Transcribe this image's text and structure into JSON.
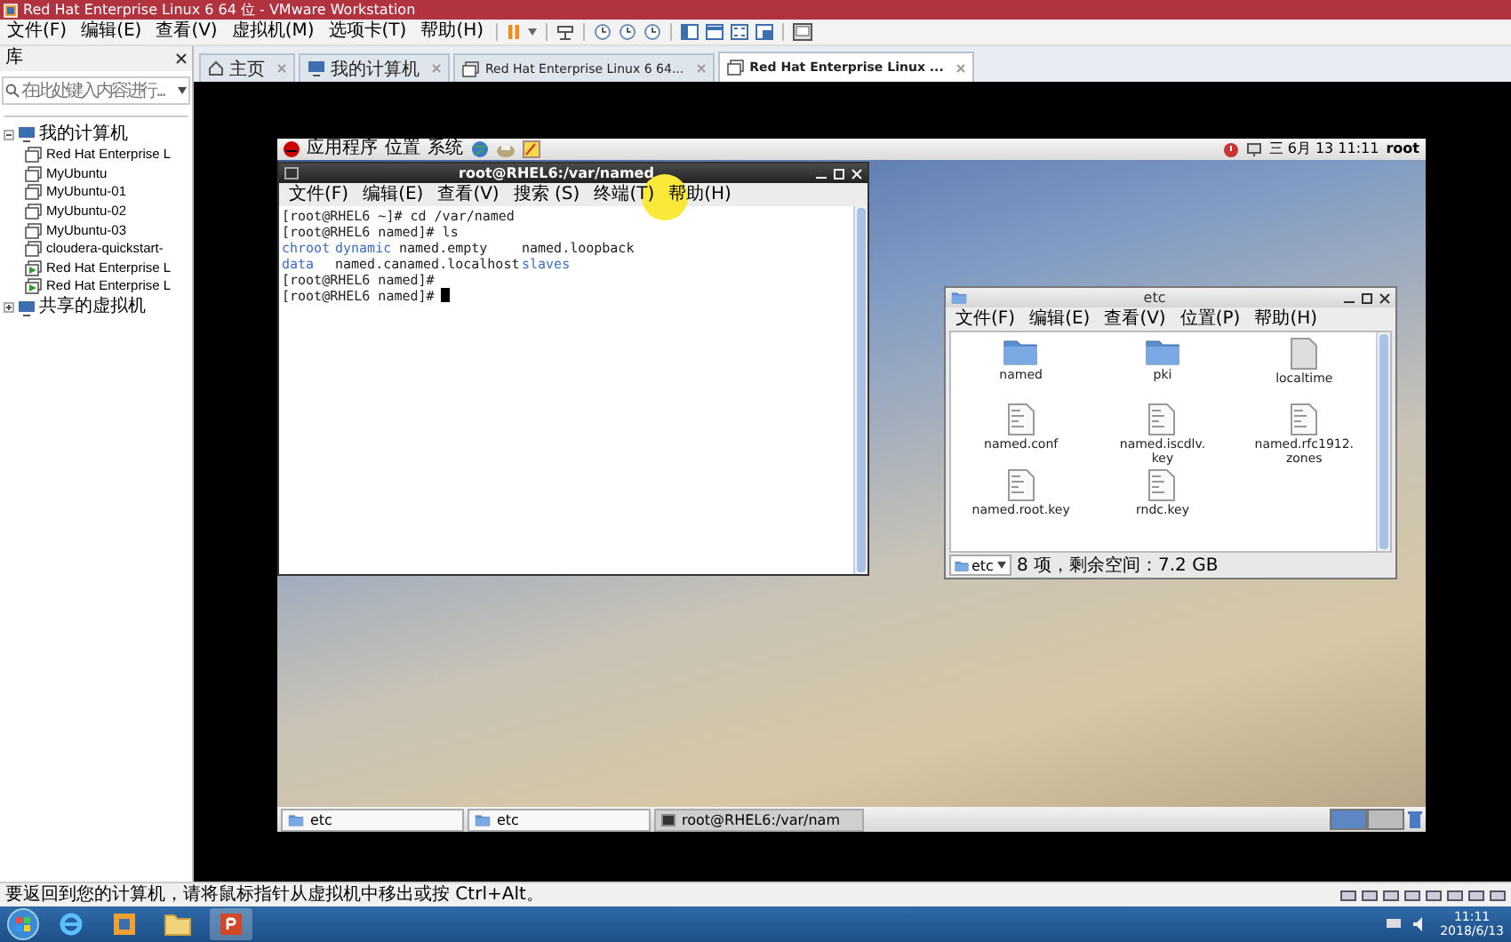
{
  "window": {
    "title": "Red Hat Enterprise Linux 6 64 位 - VMware Workstation"
  },
  "menu_bar": [
    "文件(F)",
    "编辑(E)",
    "查看(V)",
    "虚拟机(M)",
    "选项卡(T)",
    "帮助(H)"
  ],
  "library": {
    "title": "库",
    "search": {
      "placeholder": "在此处键入内容进行..."
    },
    "tree": [
      {
        "label": "我的计算机",
        "expanded": true,
        "children": [
          {
            "label": "Red Hat Enterprise L",
            "running": false
          },
          {
            "label": "MyUbuntu",
            "running": false
          },
          {
            "label": "MyUbuntu-01",
            "running": false
          },
          {
            "label": "MyUbuntu-02",
            "running": false
          },
          {
            "label": "MyUbuntu-03",
            "running": false
          },
          {
            "label": "cloudera-quickstart-",
            "running": false
          },
          {
            "label": "Red Hat Enterprise L",
            "running": true
          },
          {
            "label": "Red Hat Enterprise L",
            "running": true
          }
        ]
      },
      {
        "label": "共享的虚拟机",
        "expanded": false
      }
    ]
  },
  "tabs": [
    {
      "label": "主页",
      "kind": "home",
      "selected": false
    },
    {
      "label": "我的计算机",
      "kind": "computer",
      "selected": false
    },
    {
      "label": "Red Hat Enterprise Linux 6 64...",
      "kind": "vm",
      "selected": false
    },
    {
      "label": "Red Hat Enterprise Linux ...",
      "kind": "vm",
      "selected": true
    }
  ],
  "guest": {
    "top_panel": {
      "menus": [
        "应用程序",
        "位置",
        "系统"
      ],
      "clock": "三 6月 13 11:11",
      "user": "root"
    },
    "terminal": {
      "title": "root@RHEL6:/var/named",
      "menus": [
        "文件(F)",
        "编辑(E)",
        "查看(V)",
        "搜索 (S)",
        "终端(T)",
        "帮助(H)"
      ],
      "lines": [
        {
          "kind": "prompt",
          "text": "[root@RHEL6 ~]# cd /var/named",
          "cursor": false
        },
        {
          "kind": "prompt",
          "text": "[root@RHEL6 named]# ls",
          "cursor": false
        },
        {
          "kind": "listing",
          "entries": [
            {
              "name": "chroot",
              "kind": "dir"
            },
            {
              "name": "dynamic",
              "kind": "dir"
            },
            {
              "name": "named.empty",
              "kind": "file"
            },
            {
              "name": "named.loopback",
              "kind": "file"
            }
          ]
        },
        {
          "kind": "listing",
          "entries": [
            {
              "name": "data",
              "kind": "dir"
            },
            {
              "name": "named.ca",
              "kind": "file"
            },
            {
              "name": "named.localhost",
              "kind": "file"
            },
            {
              "name": "slaves",
              "kind": "dir"
            }
          ]
        },
        {
          "kind": "prompt",
          "text": "[root@RHEL6 named]#",
          "cursor": false
        },
        {
          "kind": "prompt",
          "text": "[root@RHEL6 named]#",
          "cursor": true
        }
      ]
    },
    "file_manager": {
      "title": "etc",
      "menus": [
        "文件(F)",
        "编辑(E)",
        "查看(V)",
        "位置(P)",
        "帮助(H)"
      ],
      "items": [
        {
          "name": "named",
          "kind": "folder"
        },
        {
          "name": "pki",
          "kind": "folder"
        },
        {
          "name": "localtime",
          "kind": "file"
        },
        {
          "name": "named.conf",
          "kind": "text"
        },
        {
          "name": "named.iscdlv.key",
          "kind": "text"
        },
        {
          "name": "named.rfc1912.zones",
          "kind": "text"
        },
        {
          "name": "named.root.key",
          "kind": "text"
        },
        {
          "name": "rndc.key",
          "kind": "text"
        }
      ],
      "location": "etc",
      "status": "8 项，剩余空间：7.2 GB"
    },
    "bottom_panel": [
      {
        "label": "etc",
        "kind": "folder",
        "selected": false
      },
      {
        "label": "etc",
        "kind": "folder",
        "selected": false
      },
      {
        "label": "root@RHEL6:/var/nam",
        "kind": "terminal",
        "selected": true
      }
    ]
  },
  "status_bar": {
    "message": "要返回到您的计算机，请将鼠标指针从虚拟机中移出或按 Ctrl+Alt。"
  },
  "taskbar": {
    "time": "11:11",
    "date": "2018/6/13"
  }
}
